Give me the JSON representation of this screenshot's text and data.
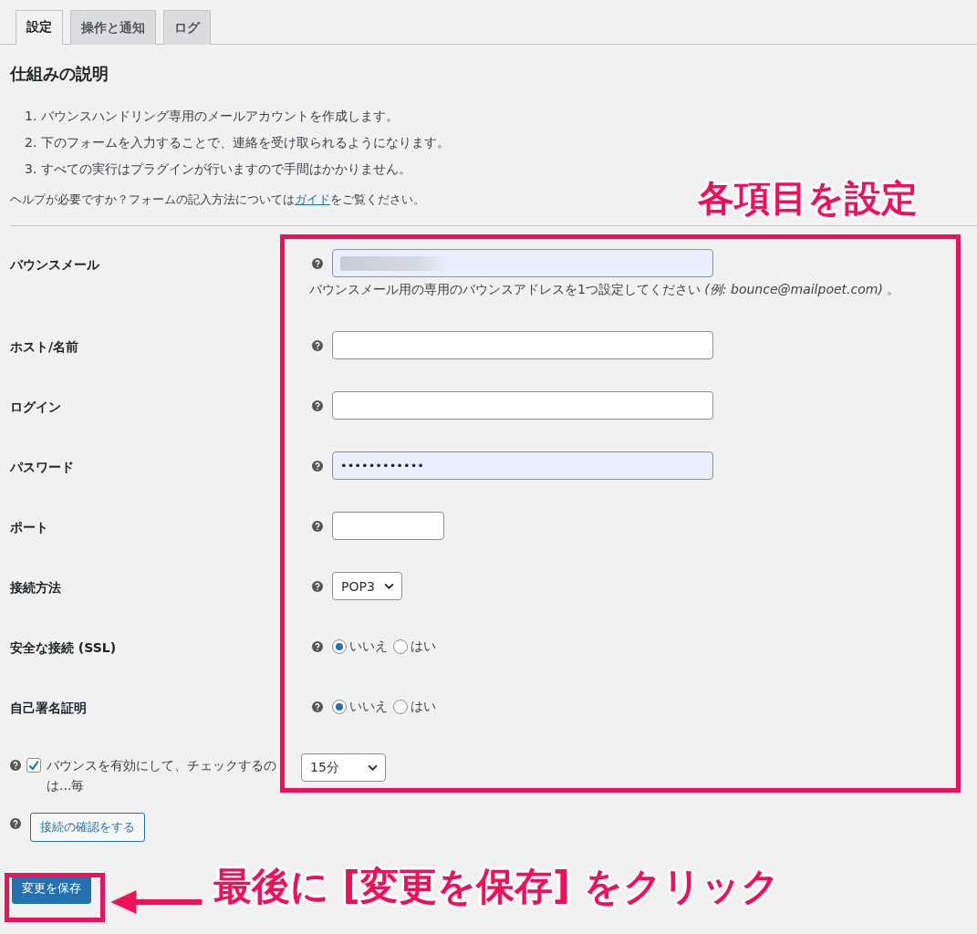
{
  "tabs": [
    {
      "label": "設定",
      "selected": true
    },
    {
      "label": "操作と通知",
      "selected": false
    },
    {
      "label": "ログ",
      "selected": false
    }
  ],
  "heading": "仕組みの説明",
  "steps": [
    "1. バウンスハンドリング専用のメールアカウントを作成します。",
    "2. 下のフォームを入力することで、連絡を受け取られるようになります。",
    "3. すべての実行はプラグインが行いますので手間はかかりません。"
  ],
  "help": {
    "before": "ヘルプが必要ですか？フォームの記入方法については",
    "link": "ガイド",
    "after": "をご覧ください。"
  },
  "fields": [
    {
      "kind": "text",
      "label": "バウンスメール",
      "autofilled": true,
      "redacted": true,
      "description": "バウンスメール用の専用のバウンスアドレスを1つ設定してください *(例: bounce@mailpoet.com)* 。"
    },
    {
      "kind": "text",
      "label": "ホスト/名前",
      "autofilled": false
    },
    {
      "kind": "text",
      "label": "ログイン",
      "autofilled": false
    },
    {
      "kind": "text",
      "label": "パスワード",
      "autofilled": true,
      "value": "••••••••••••"
    },
    {
      "kind": "short-text",
      "label": "ポート",
      "autofilled": false
    },
    {
      "kind": "select",
      "label": "接続方法",
      "value": "POP3"
    },
    {
      "kind": "radio",
      "label": "安全な接続 (SSL)",
      "options": [
        {
          "label": "いいえ",
          "selected": true
        },
        {
          "label": "はい",
          "selected": false
        }
      ]
    },
    {
      "kind": "radio",
      "label": "自己署名証明",
      "options": [
        {
          "label": "いいえ",
          "selected": true
        },
        {
          "label": "はい",
          "selected": false
        }
      ]
    }
  ],
  "interval": {
    "label": "バウンスを有効にして、チェックするのは...毎",
    "checked": true,
    "value": "15分"
  },
  "test_button": "接続の確認をする",
  "save_button": "変更を保存",
  "annotations": {
    "fields_note": "各項目を設定",
    "save_note": "最後に [変更を保存] をクリック"
  }
}
